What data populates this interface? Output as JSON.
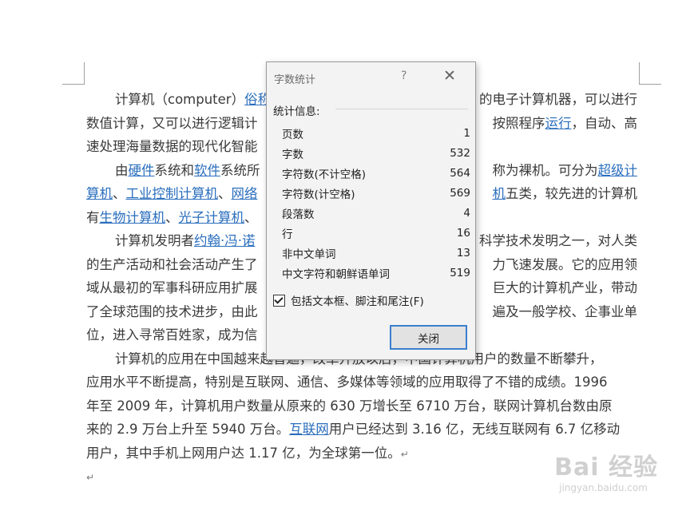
{
  "document": {
    "lines": [
      {
        "segs": [
          {
            "t": "计算机（computer）"
          },
          {
            "t": "俗称",
            "link": true
          }
        ],
        "tail": "的电子计算机器，可以进行",
        "indent": true
      },
      {
        "segs": [
          {
            "t": "数值计算，又可以进行逻辑计"
          }
        ],
        "tail": "按照程序",
        "tailLink": "运行",
        "tail2": "，自动、高",
        "indent": false
      },
      {
        "segs": [
          {
            "t": "速处理海量数据的现代化智能"
          }
        ],
        "tail": "",
        "indent": false
      },
      {
        "segs": [
          {
            "t": "由"
          },
          {
            "t": "硬件",
            "link": true
          },
          {
            "t": "系统和"
          },
          {
            "t": "软件",
            "link": true
          },
          {
            "t": "系统所"
          }
        ],
        "tail": "称为裸机。可分为",
        "tailLink": "超级计",
        "tail2": "",
        "indent": true
      },
      {
        "segs": [
          {
            "t": "算机",
            "link": true
          },
          {
            "t": "、"
          },
          {
            "t": "工业控制计算机",
            "link": true
          },
          {
            "t": "、"
          },
          {
            "t": "网络",
            "link": true
          }
        ],
        "tailLink": "机",
        "tail2": "五类，较先进的计算机",
        "indent": false
      },
      {
        "segs": [
          {
            "t": "有"
          },
          {
            "t": "生物计算机",
            "link": true
          },
          {
            "t": "、"
          },
          {
            "t": "光子计算机",
            "link": true
          },
          {
            "t": "、"
          }
        ],
        "tail": "",
        "indent": false
      },
      {
        "segs": [
          {
            "t": "计算机发明者"
          },
          {
            "t": "约翰·冯·诺",
            "link": true
          }
        ],
        "tail": "科学技术发明之一，对人类",
        "indent": true
      },
      {
        "segs": [
          {
            "t": "的生产活动和社会活动产生了"
          }
        ],
        "tail": "力飞速发展。它的应用领",
        "indent": false
      },
      {
        "segs": [
          {
            "t": "域从最初的军事科研应用扩展"
          }
        ],
        "tail": "巨大的计算机产业，带动",
        "indent": false
      },
      {
        "segs": [
          {
            "t": "了全球范围的技术进步，由此"
          }
        ],
        "tail": "遍及一般学校、企事业单",
        "indent": false
      },
      {
        "segs": [
          {
            "t": "位，进入寻常百姓家，成为信"
          }
        ],
        "tail": "",
        "indent": false
      },
      {
        "segs": [
          {
            "t": "计算机的应用在中国越来越普遍，改革开放以后，中国计算机用户的数量不断攀升，"
          }
        ],
        "tail": "",
        "indent": true
      },
      {
        "segs": [
          {
            "t": "应用水平不断提高，特别是互联网、通信、多媒体等领域的应用取得了不错的成绩。1996"
          }
        ],
        "tail": "",
        "indent": false
      },
      {
        "segs": [
          {
            "t": "年至 2009  年，计算机用户数量从原来的 630 万增长至 6710  万台，联网计算机台数由原"
          }
        ],
        "tail": "",
        "indent": false
      },
      {
        "segs": [
          {
            "t": "来的 2.9 万台上升至 5940 万台。"
          },
          {
            "t": "互联网",
            "link": true
          },
          {
            "t": "用户已经达到 3.16  亿，无线互联网有 6.7  亿移动"
          }
        ],
        "tail": "",
        "indent": false
      },
      {
        "segs": [
          {
            "t": "用户，其中手机上网用户达 1.17  亿，为全球第一位。"
          },
          {
            "t": "↵",
            "mark": true
          }
        ],
        "tail": "",
        "indent": false
      },
      {
        "segs": [
          {
            "t": "↵",
            "mark": true
          }
        ],
        "tail": "",
        "indent": false
      }
    ]
  },
  "dialog": {
    "title": "字数统计",
    "help": "?",
    "close_glyph": "✕",
    "section_label": "统计信息:",
    "stats": [
      {
        "label": "页数",
        "value": "1"
      },
      {
        "label": "字数",
        "value": "532"
      },
      {
        "label": "字符数(不计空格)",
        "value": "564"
      },
      {
        "label": "字符数(计空格)",
        "value": "569"
      },
      {
        "label": "段落数",
        "value": "4"
      },
      {
        "label": "行",
        "value": "16"
      },
      {
        "label": "非中文单词",
        "value": "13"
      },
      {
        "label": "中文字符和朝鲜语单词",
        "value": "519"
      }
    ],
    "checkbox_label": "包括文本框、脚注和尾注(F)",
    "checkbox_checked": true,
    "close_button": "关闭"
  },
  "watermark": {
    "main": "Bai 经验",
    "sub": "jingyan.baidu.com"
  },
  "colors": {
    "link": "#2a6ebd",
    "focus_border": "#3c7fcf"
  }
}
